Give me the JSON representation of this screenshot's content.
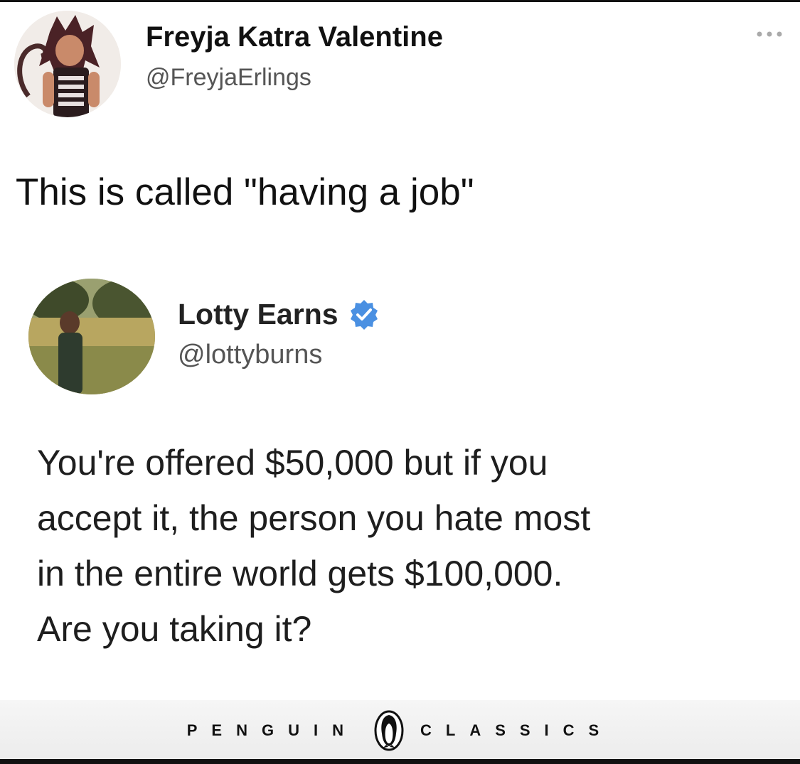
{
  "tweet": {
    "author": {
      "name": "Freyja Katra Valentine",
      "handle": "@FreyjaErlings",
      "avatar": "cartoon-cat-girl-avatar"
    },
    "text": "This is called \"having a job\"",
    "more_icon": "ellipsis-icon"
  },
  "quoted_tweet": {
    "author": {
      "name": "Lotty Earns",
      "handle": "@lottyburns",
      "verified_icon": "verified-badge-icon",
      "verified_color": "#4a90e2",
      "avatar": "woman-in-field-photo"
    },
    "lines": [
      "You're offered $50,000 but if you",
      "accept it, the person you hate most",
      "in the entire world gets $100,000.",
      "Are you taking it?"
    ]
  },
  "footer": {
    "left_word": "PENGUIN",
    "right_word": "CLASSICS",
    "logo_icon": "penguin-logo-icon"
  }
}
